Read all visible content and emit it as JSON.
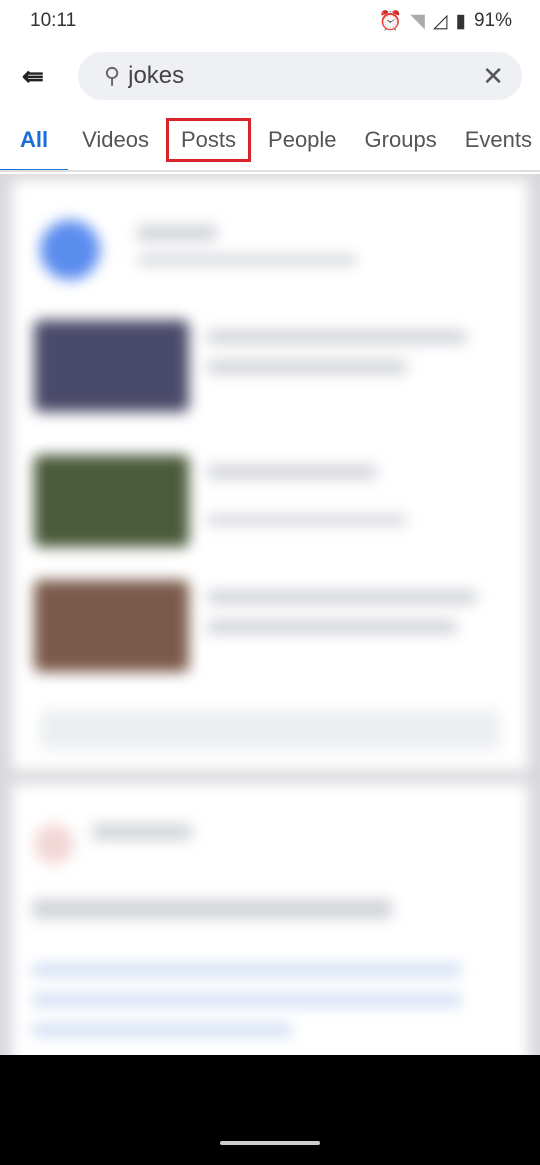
{
  "status_bar": {
    "time": "10:11",
    "battery": "91%",
    "icons": [
      "alarm-icon",
      "wifi-icon",
      "signal-icon",
      "battery-icon"
    ]
  },
  "search": {
    "value": "jokes",
    "back_icon": "back-arrow-icon",
    "search_icon": "search-icon",
    "clear_icon": "close-icon"
  },
  "tabs": [
    {
      "label": "All",
      "active": true
    },
    {
      "label": "Videos"
    },
    {
      "label": "Posts",
      "highlighted": true
    },
    {
      "label": "People"
    },
    {
      "label": "Groups"
    },
    {
      "label": "Events"
    }
  ],
  "colors": {
    "accent": "#1a6ed8",
    "highlight": "#d8232a"
  }
}
